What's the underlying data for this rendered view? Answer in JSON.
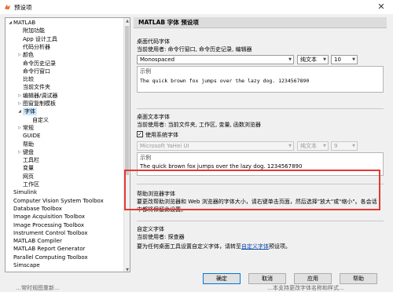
{
  "window": {
    "title": "预设项",
    "close_glyph": "✕"
  },
  "tree": {
    "items": [
      {
        "label": "MATLAB",
        "arrow": "◢",
        "level": 0
      },
      {
        "label": "附加功能",
        "arrow": "",
        "level": 1
      },
      {
        "label": "App 设计工具",
        "arrow": "",
        "level": 1
      },
      {
        "label": "代码分析器",
        "arrow": "",
        "level": 1
      },
      {
        "label": "颜色",
        "arrow": "▷",
        "level": 1
      },
      {
        "label": "命令历史记录",
        "arrow": "",
        "level": 1
      },
      {
        "label": "命令行窗口",
        "arrow": "",
        "level": 1
      },
      {
        "label": "比较",
        "arrow": "",
        "level": 1
      },
      {
        "label": "当前文件夹",
        "arrow": "",
        "level": 1
      },
      {
        "label": "编辑器/调试器",
        "arrow": "▷",
        "level": 1
      },
      {
        "label": "图窗复制模板",
        "arrow": "▷",
        "level": 1
      },
      {
        "label": "字体",
        "arrow": "◢",
        "level": 1,
        "selected": true
      },
      {
        "label": "自定义",
        "arrow": "",
        "level": 2
      },
      {
        "label": "常规",
        "arrow": "▷",
        "level": 1
      },
      {
        "label": "GUIDE",
        "arrow": "",
        "level": 1
      },
      {
        "label": "帮助",
        "arrow": "",
        "level": 1
      },
      {
        "label": "键盘",
        "arrow": "▷",
        "level": 1
      },
      {
        "label": "工具栏",
        "arrow": "",
        "level": 1
      },
      {
        "label": "变量",
        "arrow": "",
        "level": 1
      },
      {
        "label": "网页",
        "arrow": "",
        "level": 1
      },
      {
        "label": "工作区",
        "arrow": "",
        "level": 1
      },
      {
        "label": "Simulink",
        "arrow": "",
        "level": 0
      },
      {
        "label": "Computer Vision System Toolbox",
        "arrow": "",
        "level": 0
      },
      {
        "label": "Database Toolbox",
        "arrow": "",
        "level": 0
      },
      {
        "label": "Image Acquisition Toolbox",
        "arrow": "",
        "level": 0
      },
      {
        "label": "Image Processing Toolbox",
        "arrow": "",
        "level": 0
      },
      {
        "label": "Instrument Control Toolbox",
        "arrow": "",
        "level": 0
      },
      {
        "label": "MATLAB Compiler",
        "arrow": "",
        "level": 0
      },
      {
        "label": "MATLAB Report Generator",
        "arrow": "",
        "level": 0
      },
      {
        "label": "Parallel Computing Toolbox",
        "arrow": "",
        "level": 0
      },
      {
        "label": "Simscape",
        "arrow": "",
        "level": 0
      }
    ],
    "scroll_up": "▲",
    "scroll_down": "▼"
  },
  "panel": {
    "header": "MATLAB 字体 预设项",
    "desktop_code": {
      "title": "桌面代码字体",
      "subtitle": "当前使用者: 命令行窗口, 命令历史记录, 编辑器",
      "font": "Monospaced",
      "style": "纯文本",
      "size": "10",
      "sample_label": "示例",
      "sample_text": "The quick brown fox jumps over the lazy dog.  1234567890"
    },
    "desktop_text": {
      "title": "桌面文本字体",
      "subtitle": "当前使用者: 当前文件夹, 工作区, 变量, 函数浏览器",
      "use_system_font": "使用系统字体",
      "checkmark": "✓",
      "font": "Microsoft YaHei UI",
      "style": "纯文本",
      "size": "9",
      "sample_label": "示例",
      "sample_text": "The quick brown fox jumps over the lazy dog.  1234567890"
    },
    "help_browser": {
      "title": "帮助浏览器字体",
      "description": "要更改帮助浏览器和 Web 浏览器的字体大小，请右键单击页面，然后选择\"放大\"或\"缩小\"。各会话中都将保留此设置。"
    },
    "custom": {
      "title": "自定义字体",
      "subtitle": "当前使用者: 探查器",
      "text_before": "要为任何桌面工具设置自定义字体，请转至",
      "link": "自定义字体",
      "text_after": "预设项。"
    },
    "caret": "▼"
  },
  "buttons": {
    "ok": "确定",
    "cancel": "取消",
    "apply": "应用",
    "help": "帮助"
  },
  "bottom_strip": {
    "left": "…常时规图重新…",
    "right": "…本支持更改字体名称和样式…"
  }
}
